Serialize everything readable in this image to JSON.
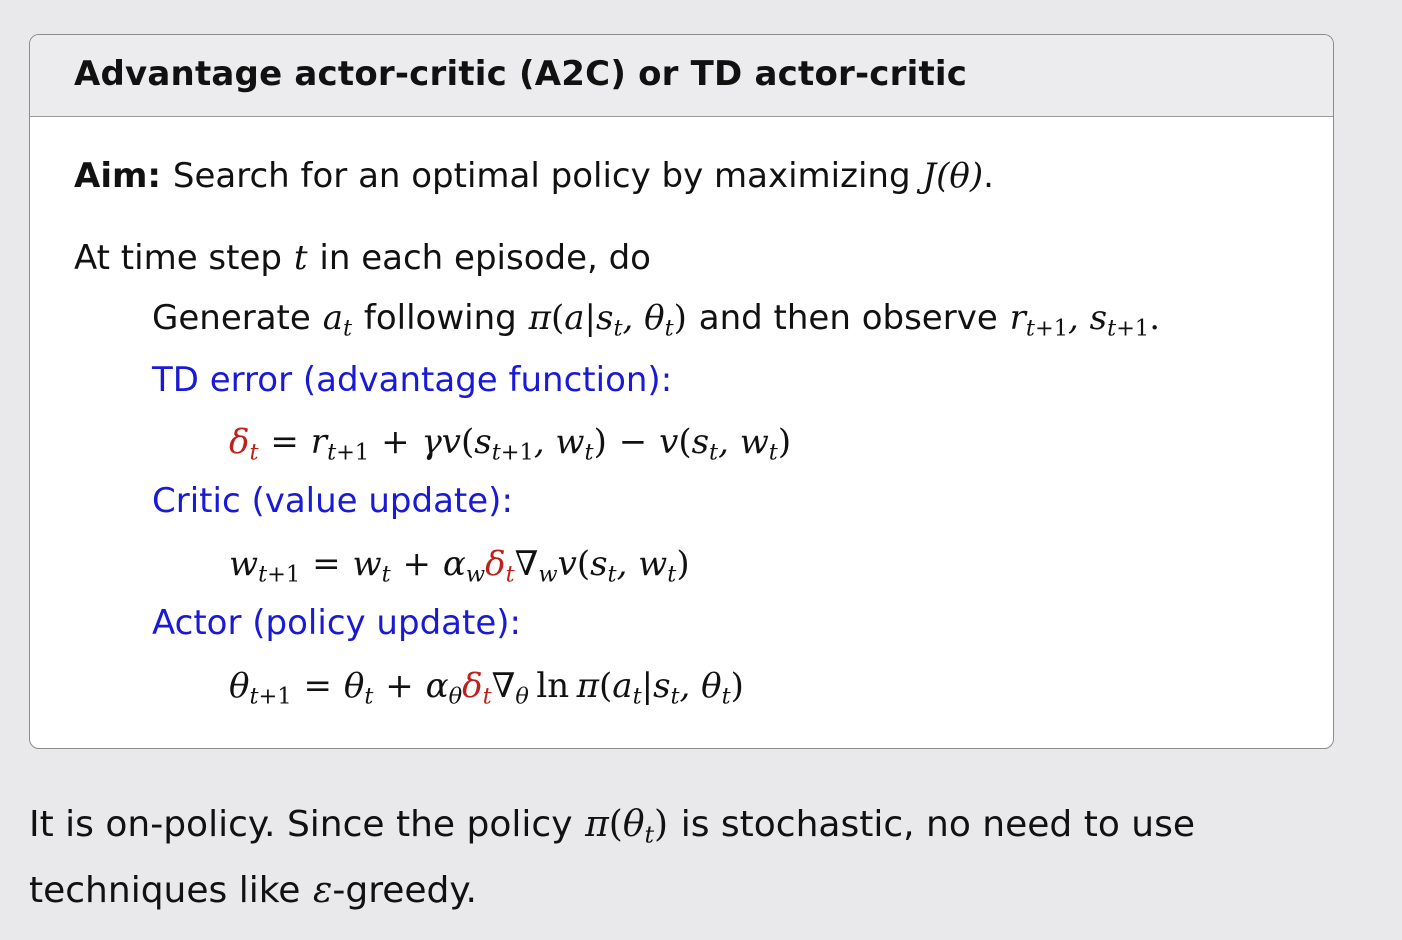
{
  "block": {
    "title": "Advantage actor-critic (A2C) or TD actor-critic"
  },
  "aim": {
    "label": "Aim:",
    "text": "Search for an optimal policy by maximizing",
    "math": "J(θ)",
    "end": "."
  },
  "loop": {
    "pre": "At time step",
    "var": "t",
    "post": "in each episode, do"
  },
  "generate": {
    "pre": "Generate",
    "mid": "following",
    "post": "and then observe"
  },
  "td_label": "TD error (advantage function):",
  "critic_label": "Critic (value update):",
  "actor_label": "Actor (policy update):",
  "footer": {
    "line1_pre": "It is on-policy.  Since the policy",
    "line1_post": "is stochastic, no need to use",
    "line2_pre": "techniques like",
    "line2_post": "-greedy."
  },
  "colors": {
    "background": "#e9e8ea",
    "header": "#ececee",
    "blue": "#1a1ad6",
    "red": "#c0201a"
  }
}
